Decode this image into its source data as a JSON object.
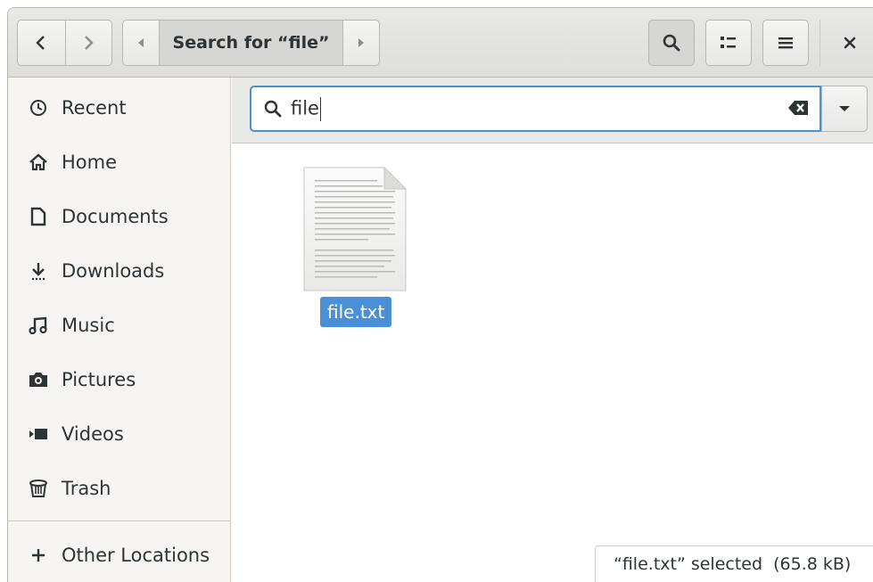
{
  "header": {
    "path_current": "Search for “file”",
    "back_icon": "chevron-left-icon",
    "forward_icon": "chevron-right-icon",
    "search_toggle_icon": "search-icon",
    "view_toggle_icon": "list-view-icon",
    "menu_icon": "hamburger-menu-icon",
    "close_icon": "close-icon"
  },
  "sidebar": {
    "items": [
      {
        "label": "Recent",
        "icon": "clock-icon"
      },
      {
        "label": "Home",
        "icon": "home-icon"
      },
      {
        "label": "Documents",
        "icon": "document-icon"
      },
      {
        "label": "Downloads",
        "icon": "download-icon"
      },
      {
        "label": "Music",
        "icon": "music-icon"
      },
      {
        "label": "Pictures",
        "icon": "camera-icon"
      },
      {
        "label": "Videos",
        "icon": "video-icon"
      },
      {
        "label": "Trash",
        "icon": "trash-icon"
      }
    ],
    "other_locations": {
      "label": "Other Locations",
      "icon": "plus-icon"
    }
  },
  "search": {
    "value": "file"
  },
  "files": [
    {
      "name": "file.txt",
      "selected": true
    }
  ],
  "status": {
    "text": "“file.txt” selected  (65.8 kB)"
  },
  "colors": {
    "accent": "#4a90d9",
    "sidebar_bg": "#f6f5f4",
    "header_bg": "#e8e8e7"
  }
}
